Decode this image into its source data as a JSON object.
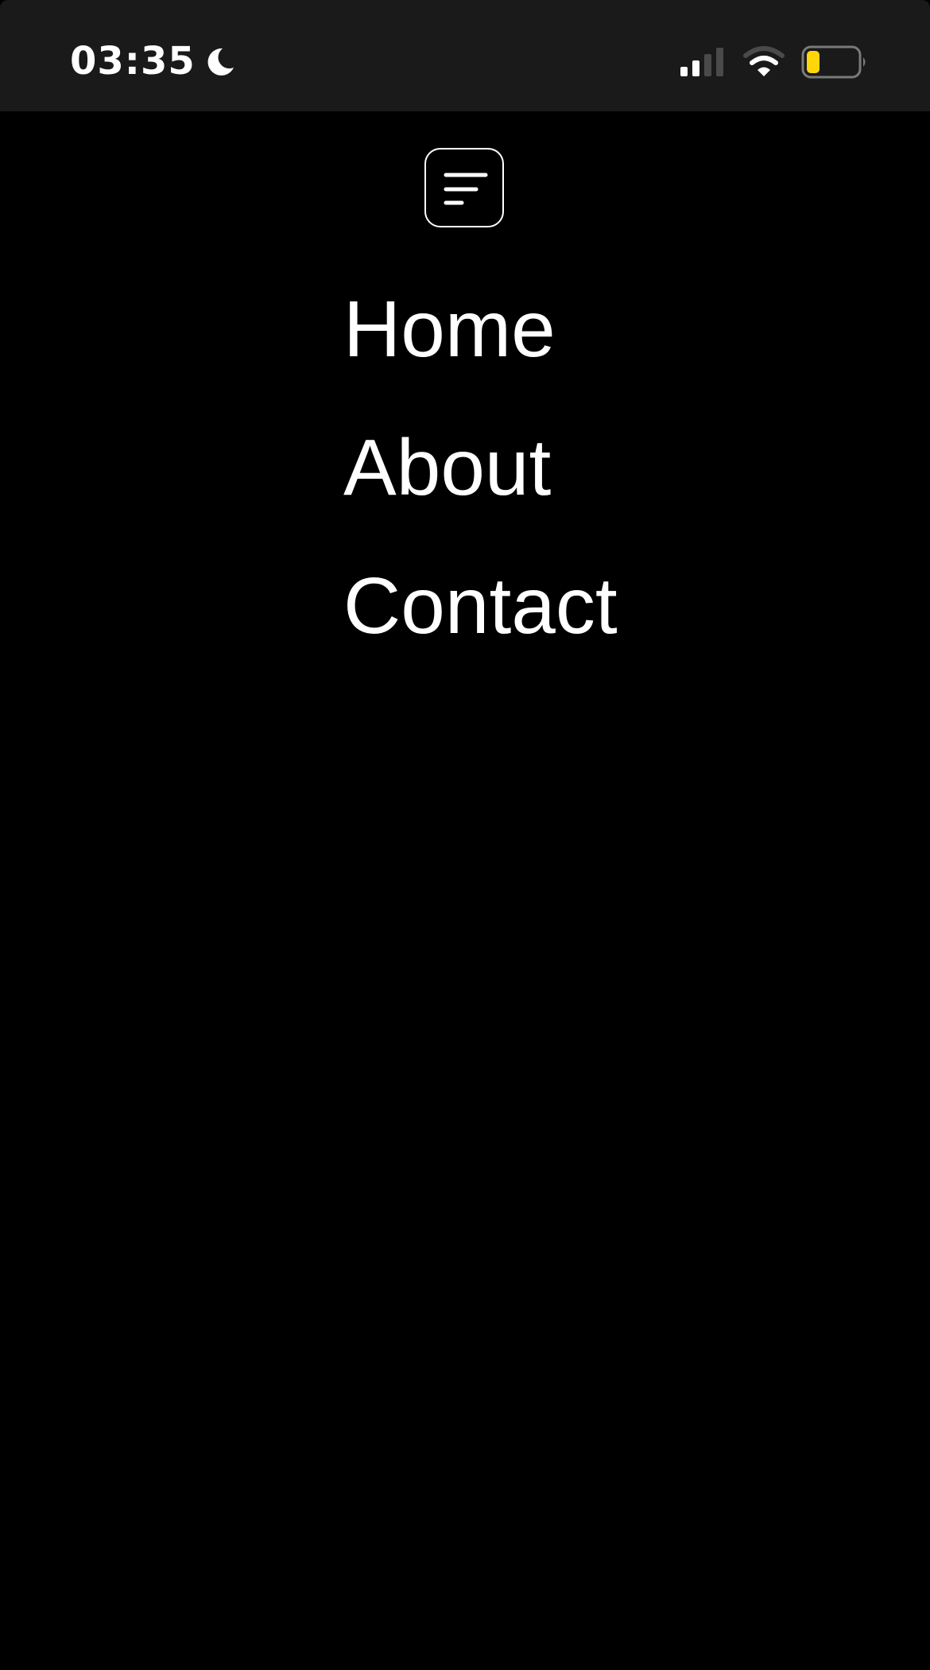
{
  "status_bar": {
    "time": "03:35",
    "focus_icon": "moon-icon",
    "signal_icon": "cellular-signal-icon",
    "signal_bars_active": 2,
    "signal_bars_total": 4,
    "wifi_icon": "wifi-icon",
    "battery_icon": "battery-icon",
    "battery_level": 0.2,
    "battery_color": "#ffd60a",
    "background": "#1a1a1a"
  },
  "menu_button": {
    "icon": "menu-lines-icon"
  },
  "nav": {
    "items": [
      {
        "label": "Home"
      },
      {
        "label": "About"
      },
      {
        "label": "Contact"
      }
    ]
  },
  "colors": {
    "background": "#000000",
    "foreground": "#ffffff"
  }
}
